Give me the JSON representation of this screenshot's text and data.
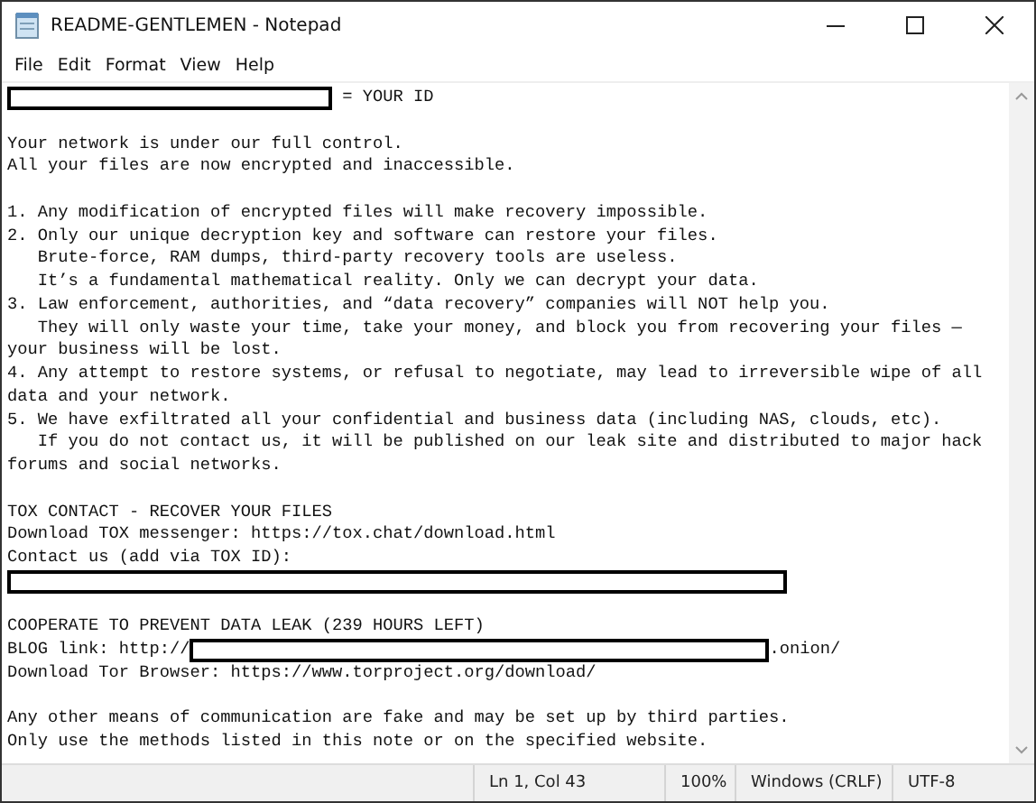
{
  "window": {
    "title": "README-GENTLEMEN - Notepad"
  },
  "menu": [
    "File",
    "Edit",
    "Format",
    "View",
    "Help"
  ],
  "lines": [
    {
      "kind": "id",
      "text": "= YOUR ID"
    },
    {
      "kind": "blank"
    },
    {
      "kind": "text",
      "text": "Your network is under our full control."
    },
    {
      "kind": "text",
      "text": "All your files are now encrypted and inaccessible."
    },
    {
      "kind": "blank"
    },
    {
      "kind": "text",
      "text": "1. Any modification of encrypted files will make recovery impossible."
    },
    {
      "kind": "text",
      "text": "2. Only our unique decryption key and software can restore your files."
    },
    {
      "kind": "text",
      "text": "   Brute-force, RAM dumps, third-party recovery tools are useless."
    },
    {
      "kind": "text",
      "text": "   It’s a fundamental mathematical reality. Only we can decrypt your data."
    },
    {
      "kind": "text",
      "text": "3. Law enforcement, authorities, and “data recovery” companies will NOT help you."
    },
    {
      "kind": "text",
      "text": "   They will only waste your time, take your money, and block you from recovering your files —"
    },
    {
      "kind": "text",
      "text": "your business will be lost."
    },
    {
      "kind": "text",
      "text": "4. Any attempt to restore systems, or refusal to negotiate, may lead to irreversible wipe of all"
    },
    {
      "kind": "text",
      "text": "data and your network."
    },
    {
      "kind": "text",
      "text": "5. We have exfiltrated all your confidential and business data (including NAS, clouds, etc)."
    },
    {
      "kind": "text",
      "text": "   If you do not contact us, it will be published on our leak site and distributed to major hack"
    },
    {
      "kind": "text",
      "text": "forums and social networks."
    },
    {
      "kind": "blank"
    },
    {
      "kind": "text",
      "text": "TOX CONTACT - RECOVER YOUR FILES"
    },
    {
      "kind": "text",
      "text": "Download TOX messenger: https://tox.chat/download.html"
    },
    {
      "kind": "text",
      "text": "Contact us (add via TOX ID):"
    },
    {
      "kind": "redacted"
    },
    {
      "kind": "blank"
    },
    {
      "kind": "text",
      "text": "COOPERATE TO PREVENT DATA LEAK (239 HOURS LEFT)"
    },
    {
      "kind": "link",
      "before": "BLOG link: http://",
      "after": ".onion/"
    },
    {
      "kind": "text",
      "text": "Download Tor Browser: https://www.torproject.org/download/"
    },
    {
      "kind": "blank"
    },
    {
      "kind": "text",
      "text": "Any other means of communication are fake and may be set up by third parties."
    },
    {
      "kind": "text",
      "text": "Only use the methods listed in this note or on the specified website."
    }
  ],
  "status_bar": [
    "Ln 1, Col 43",
    "100%",
    "Windows (CRLF)",
    "UTF-8"
  ]
}
